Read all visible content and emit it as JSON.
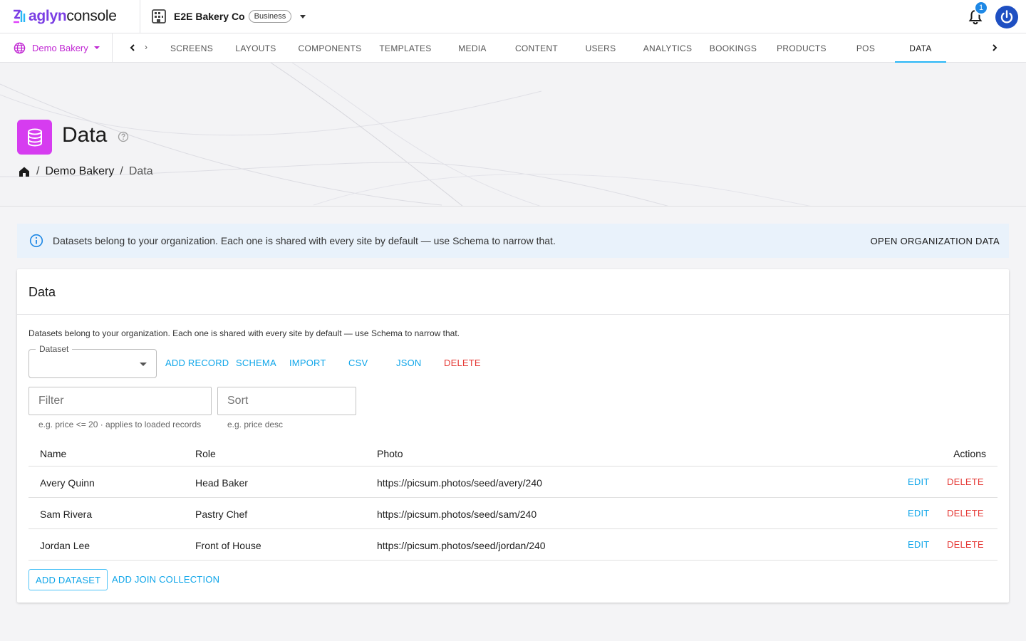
{
  "brand": {
    "prefix": "aglyn",
    "suffix": "console"
  },
  "org": {
    "name": "E2E Bakery Co",
    "badge": "Business"
  },
  "notifications": {
    "count": "1"
  },
  "site": {
    "name": "Demo Bakery"
  },
  "nav": {
    "overflow_glyph": "›",
    "tabs": [
      "SCREENS",
      "LAYOUTS",
      "COMPONENTS",
      "TEMPLATES",
      "MEDIA",
      "CONTENT",
      "USERS",
      "ANALYTICS",
      "BOOKINGS",
      "PRODUCTS",
      "POS",
      "DATA"
    ],
    "active": "DATA"
  },
  "page": {
    "title": "Data",
    "breadcrumb": {
      "sep1": "/",
      "site": "Demo Bakery",
      "sep2": "/",
      "current": "Data"
    }
  },
  "alert": {
    "text": "Datasets belong to your organization. Each one is shared with every site by default — use Schema to narrow that.",
    "action": "OPEN ORGANIZATION DATA"
  },
  "card": {
    "title": "Data",
    "description": "Datasets belong to your organization. Each one is shared with every site by default — use Schema to narrow that.",
    "dataset_label": "Dataset",
    "toolbar": {
      "add_record": "ADD RECORD",
      "schema": "SCHEMA",
      "import": "IMPORT",
      "csv": "CSV",
      "json": "JSON",
      "delete": "DELETE"
    },
    "filter": {
      "placeholder": "Filter",
      "hint": "e.g. price <= 20 · applies to loaded records"
    },
    "sort": {
      "placeholder": "Sort",
      "hint": "e.g. price desc"
    },
    "table": {
      "headers": {
        "name": "Name",
        "role": "Role",
        "photo": "Photo",
        "actions": "Actions"
      },
      "rows": [
        {
          "name": "Avery Quinn",
          "role": "Head Baker",
          "photo": "https://picsum.photos/seed/avery/240"
        },
        {
          "name": "Sam Rivera",
          "role": "Pastry Chef",
          "photo": "https://picsum.photos/seed/sam/240"
        },
        {
          "name": "Jordan Lee",
          "role": "Front of House",
          "photo": "https://picsum.photos/seed/jordan/240"
        }
      ],
      "edit_label": "EDIT",
      "delete_label": "DELETE"
    },
    "footer": {
      "add_dataset": "ADD DATASET",
      "add_join": "ADD JOIN COLLECTION"
    }
  },
  "colors": {
    "accent": "#0ea5e9",
    "danger": "#e53935",
    "page_icon": "#d63cf0",
    "site": "#c026d3"
  },
  "icons": {
    "brand": "aglyn-logo-icon",
    "org": "building-icon",
    "notifications": "bell-icon",
    "account": "power-icon",
    "site": "globe-icon",
    "page": "database-icon",
    "help": "help-circle-icon",
    "home": "home-icon",
    "info": "info-icon"
  }
}
